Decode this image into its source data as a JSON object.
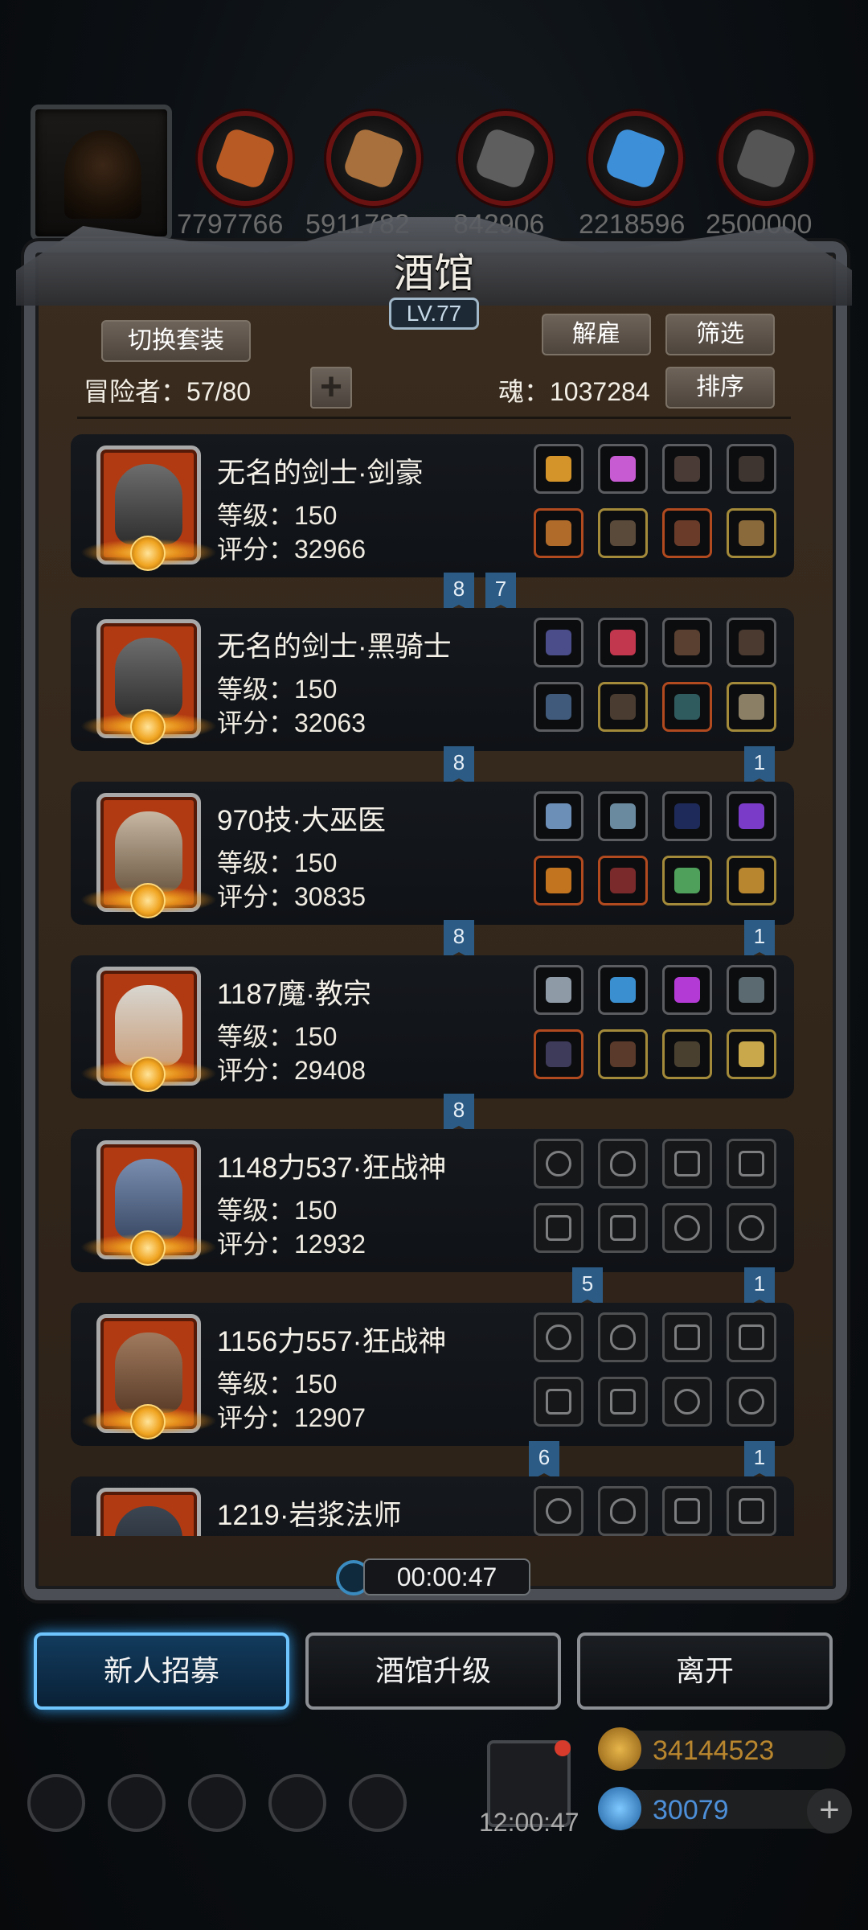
{
  "top_resources": [
    {
      "icon": "meat-icon",
      "value": "7797766",
      "color": "#c0672a"
    },
    {
      "icon": "wood-plank-icon",
      "value": "5911782",
      "color": "#a8703c"
    },
    {
      "icon": "stone-block-icon",
      "value": "842906",
      "color": "#6f6f6f"
    },
    {
      "icon": "crystal-icon",
      "value": "2218596",
      "color": "#3d8fd8"
    },
    {
      "icon": "iron-ingot-icon",
      "value": "2500000",
      "color": "#555555"
    }
  ],
  "panel": {
    "title": "酒馆",
    "level": "LV.77",
    "switch_outfit": "切换套装",
    "dismiss": "解雇",
    "filter": "筛选",
    "sort": "排序",
    "adventurers_label": "冒险者：57/80",
    "soul_label": "魂：1037284"
  },
  "roster": [
    {
      "name": "无名的剑士·剑豪",
      "level": "等级：150",
      "score": "评分：32966",
      "portrait": "knight-helmet-portrait",
      "tag_left": "8",
      "tag_right": "7"
    },
    {
      "name": "无名的剑士·黑骑士",
      "level": "等级：150",
      "score": "评分：32063",
      "portrait": "knight-helmet-portrait",
      "tag_left": "8",
      "tag_right": "1"
    },
    {
      "name": "970技·大巫医",
      "level": "等级：150",
      "score": "评分：30835",
      "portrait": "bearded-shaman-portrait",
      "tag_left": "8",
      "tag_right": "1"
    },
    {
      "name": "1187魔·教宗",
      "level": "等级：150",
      "score": "评分：29408",
      "portrait": "white-haired-youth-portrait",
      "tag_left": "8",
      "tag_right": ""
    },
    {
      "name": "1148力537·狂战神",
      "level": "等级：150",
      "score": "评分：12932",
      "portrait": "blue-skin-warrior-portrait",
      "tag_left": "5",
      "tag_right": "1"
    },
    {
      "name": "1156力557·狂战神",
      "level": "等级：150",
      "score": "评分：12907",
      "portrait": "bald-brute-portrait",
      "tag_left": "6",
      "tag_right": "1"
    },
    {
      "name": "1219·岩浆法师",
      "level": "",
      "score": "",
      "portrait": "hooded-mage-portrait",
      "tag_left": "",
      "tag_right": ""
    }
  ],
  "timer": "00:00:47",
  "buttons": {
    "recruit": "新人招募",
    "upgrade": "酒馆升级",
    "leave": "离开"
  },
  "footer": {
    "gift_timer": "12:00:47",
    "gold": "34144523",
    "gems": "30079"
  }
}
